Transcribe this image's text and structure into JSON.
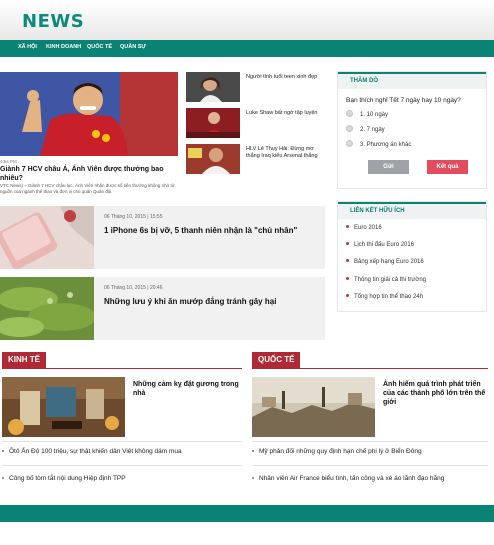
{
  "site": {
    "logo": "NEWS"
  },
  "nav": [
    "Xã hội",
    "Kinh doanh",
    "Quốc tế",
    "Quân sự"
  ],
  "hero": {
    "meta": "4:54 PM",
    "title": "Giành 7 HCV châu Á, Ánh Viên được thưởng bao nhiêu?",
    "summary": "VTC News) – Giành 7 HCV châu lục, Ánh Viên nhận được số tiền thưởng không nhỏ từ nguồn của ngành thể thao và đơn vị chủ quản Quân đội."
  },
  "side_news": [
    {
      "text": "Người tình tuổi teen xinh đẹp"
    },
    {
      "text": "Luke Shaw bất ngờ tập luyện"
    },
    {
      "text": "HLV Lê Thụy Hải: Đừng mơ thắng Iraq kiểu Arsenal thắng"
    }
  ],
  "cards": [
    {
      "date": "06 Tháng 10, 2015 | 15:55",
      "title": "1 iPhone 6s bị vỡ, 5 thanh niên nhận là \"chủ nhân\""
    },
    {
      "date": "06 Tháng 10, 2015 | 20:46",
      "title": "Những lưu ý khi ăn mướp đắng tránh gây hại"
    }
  ],
  "poll": {
    "heading": "Thăm dò",
    "question": "Bạn thích nghỉ Tết 7 ngày hay 10 ngày?",
    "options": [
      "1. 10 ngày",
      "2. 7 ngày",
      "3. Phương án khác"
    ],
    "send_label": "Gửi",
    "result_label": "Kết quả"
  },
  "links": {
    "heading": "Liên kết hữu ích",
    "items": [
      "Euro 2016",
      "Lịch thi đấu Euro 2016",
      "Bảng xếp hạng Euro 2016",
      "Thông tin giải cả thi trường",
      "Tổng hợp tin thể thao 24h"
    ]
  },
  "section_left": {
    "heading": "Kinh tế",
    "feature_title": "Những cảm kỵ đặt gương trong nhà",
    "list": [
      "Ôtô Ấn Độ 100 triệu, sự thật khiến dân Việt không dám mua",
      "Công bố tòm tắt nội dung Hiệp định TPP"
    ]
  },
  "section_right": {
    "heading": "Quốc tế",
    "feature_title": "Ảnh hiếm quá trình phát triển của các thành phố lớn trên thế giới",
    "list": [
      "Mỹ phản đối những quy định hạn chế phi lý ở Biển Đông",
      "Nhân viên Air France biểu tình, tấn công và xé áo lãnh đạo hãng"
    ]
  },
  "colors": {
    "brand": "#0a8274",
    "section": "#b02a35",
    "result_button": "#e34c5c"
  }
}
